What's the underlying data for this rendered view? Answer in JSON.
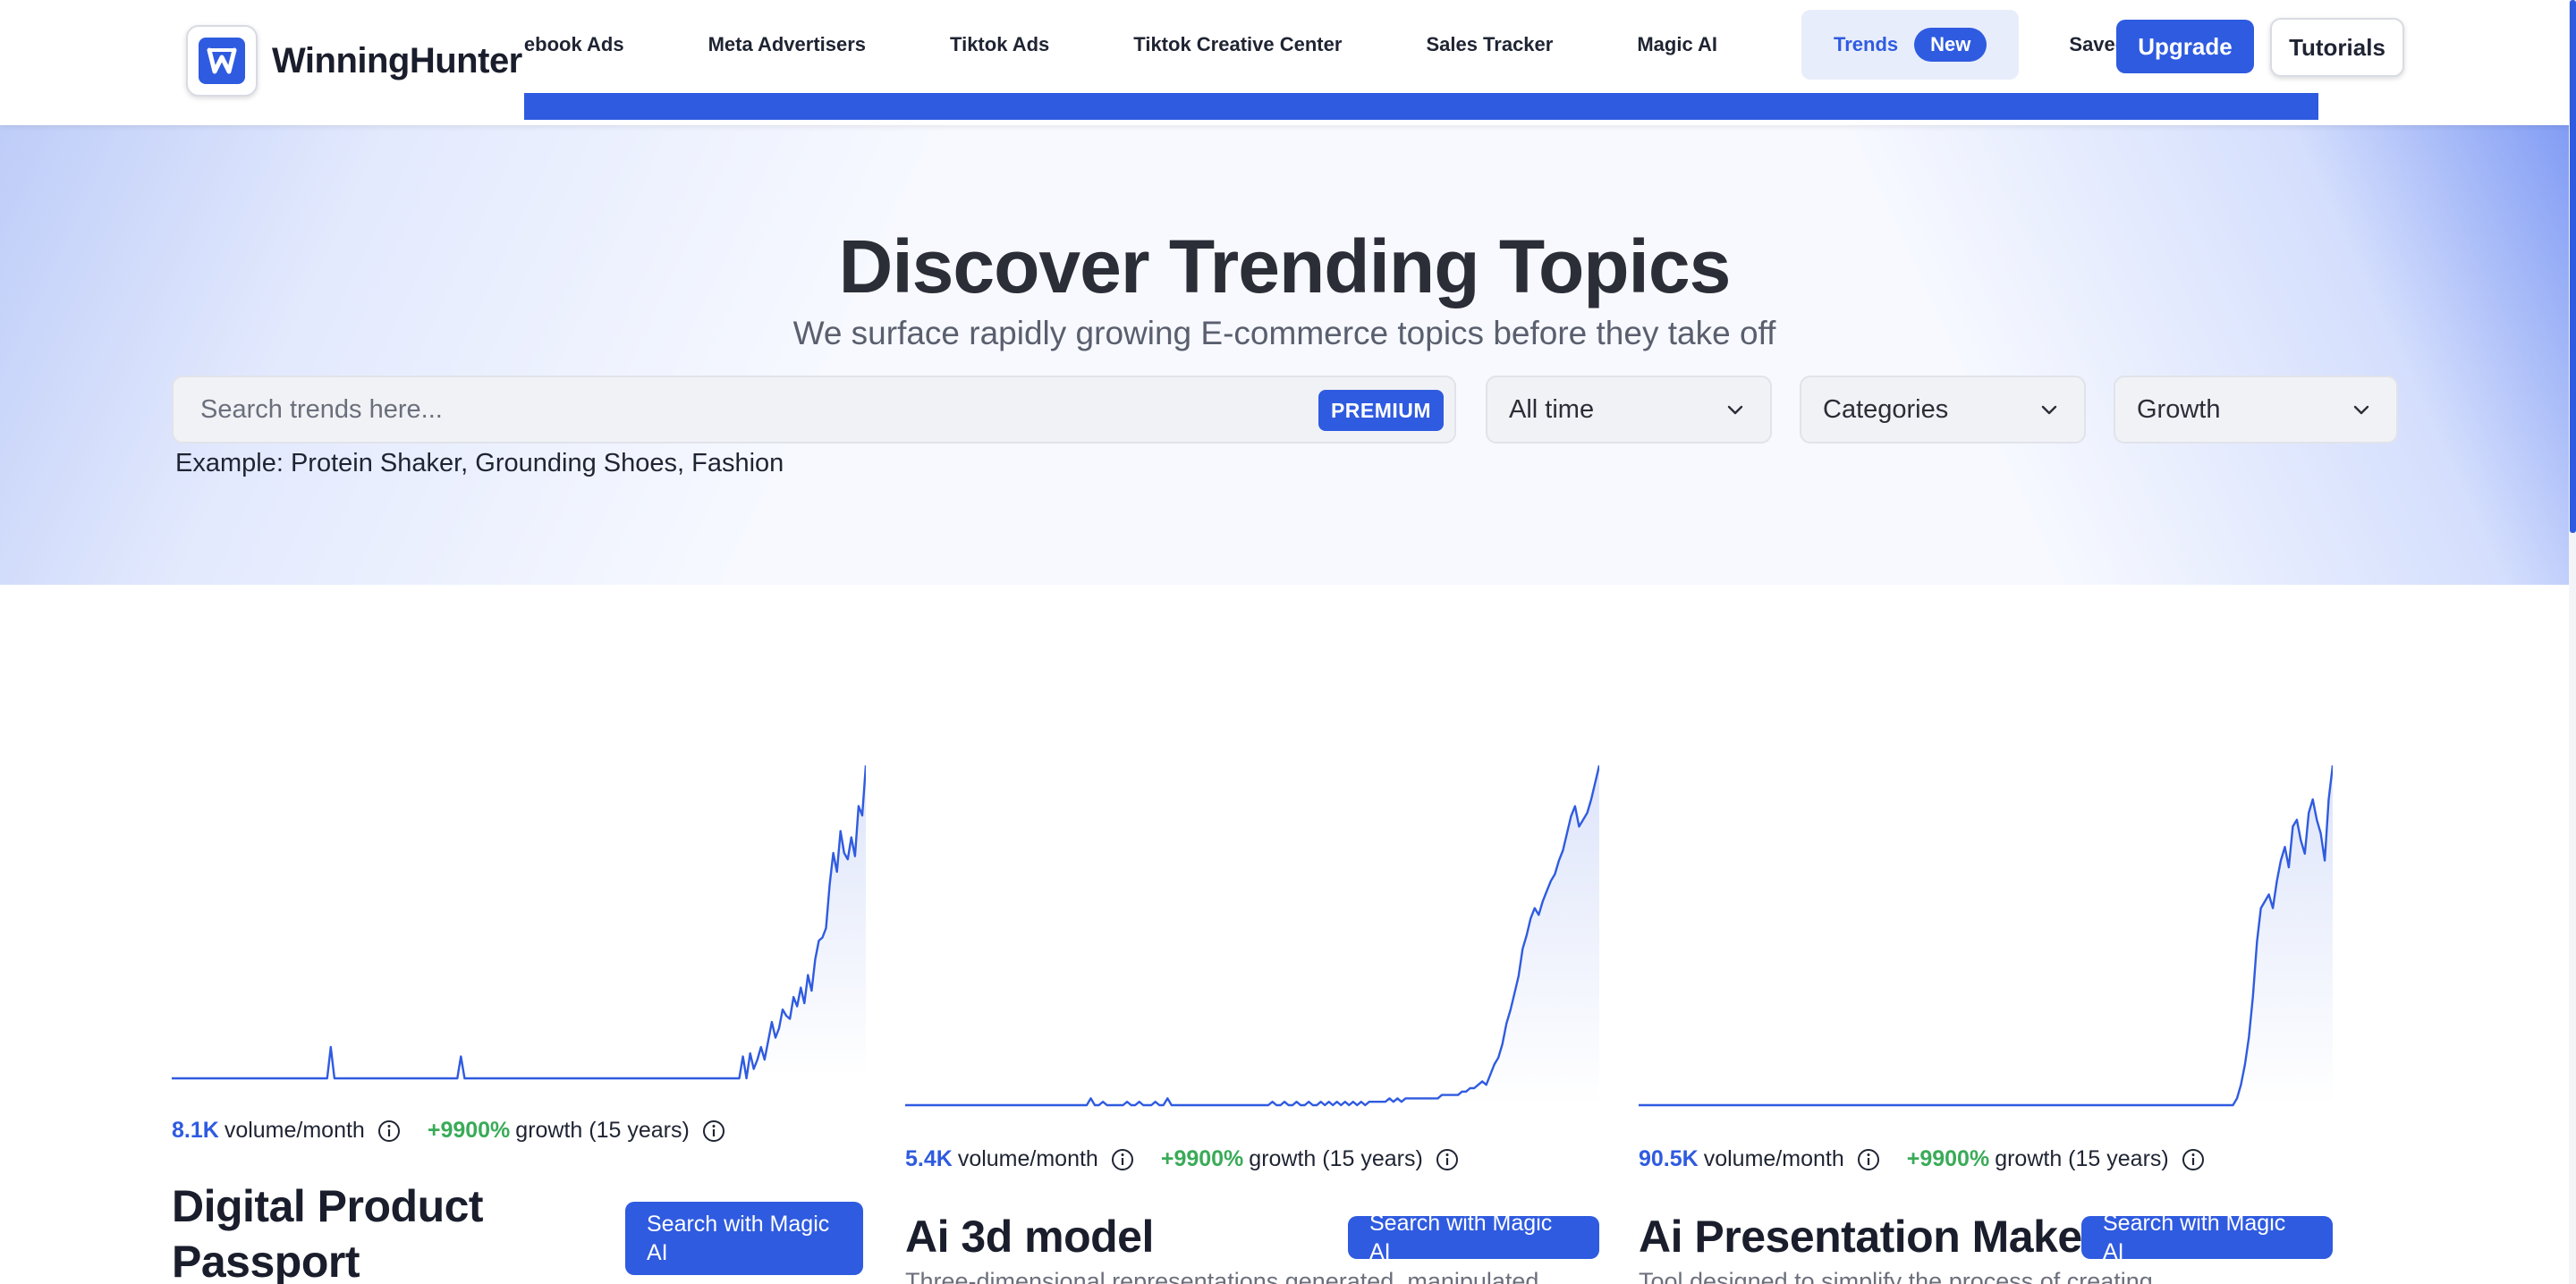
{
  "brand": {
    "name": "WinningHunter"
  },
  "nav": {
    "items": [
      "Facebook Ads",
      "Meta Advertisers",
      "Tiktok Ads",
      "Tiktok Creative Center",
      "Sales Tracker",
      "Magic AI"
    ],
    "trends_label": "Trends",
    "trends_badge": "New",
    "saved_label": "Saved Ads",
    "upgrade_label": "Upgrade",
    "tutorials_label": "Tutorials"
  },
  "hero": {
    "title": "Discover Trending Topics",
    "subtitle": "We surface rapidly growing E-commerce topics before they take off",
    "search_placeholder": "Search trends here...",
    "premium_label": "PREMIUM",
    "filters": {
      "time": "All time",
      "category": "Categories",
      "sort": "Growth"
    },
    "example": "Example: Protein Shaker, Grounding Shoes, Fashion"
  },
  "colors": {
    "accent": "#2f5be0",
    "growth": "#3aab58",
    "text": "#1f2433"
  },
  "icons": {
    "info": "info-icon",
    "chevron": "chevron-down-icon"
  },
  "cards": [
    {
      "volume": "8.1K",
      "volume_suffix": "volume/month",
      "growth": "+9900%",
      "growth_suffix": "growth (15 years)",
      "title": "Digital Product Passport",
      "button": "Search with Magic AI",
      "description": ""
    },
    {
      "volume": "5.4K",
      "volume_suffix": "volume/month",
      "growth": "+9900%",
      "growth_suffix": "growth (15 years)",
      "title": "Ai 3d model",
      "button": "Search with Magic AI",
      "description": "Three-dimensional representations generated, manipulated"
    },
    {
      "volume": "90.5K",
      "volume_suffix": "volume/month",
      "growth": "+9900%",
      "growth_suffix": "growth (15 years)",
      "title": "Ai Presentation Maker",
      "button": "Search with Magic AI",
      "description": "Tool designed to simplify the process of creating"
    }
  ],
  "chart_data": [
    {
      "type": "area",
      "series": [
        {
          "values": [
            0,
            0,
            0,
            0,
            0,
            0,
            0,
            0,
            0,
            0,
            0,
            0,
            0,
            0,
            0,
            0,
            0,
            0,
            0,
            0,
            0,
            0,
            0,
            0,
            0,
            0,
            0,
            0,
            0,
            0,
            0,
            0,
            0,
            0,
            0,
            0,
            0,
            0,
            0,
            0,
            0,
            0,
            0,
            0,
            10,
            0,
            0,
            0,
            0,
            0,
            0,
            0,
            0,
            0,
            0,
            0,
            0,
            0,
            0,
            0,
            0,
            0,
            0,
            0,
            0,
            0,
            0,
            0,
            0,
            0,
            0,
            0,
            0,
            0,
            0,
            0,
            0,
            0,
            0,
            0,
            7,
            0,
            0,
            0,
            0,
            0,
            0,
            0,
            0,
            0,
            0,
            0,
            0,
            0,
            0,
            0,
            0,
            0,
            0,
            0,
            0,
            0,
            0,
            0,
            0,
            0,
            0,
            0,
            0,
            0,
            0,
            0,
            0,
            0,
            0,
            0,
            0,
            0,
            0,
            0,
            0,
            0,
            0,
            0,
            0,
            0,
            0,
            0,
            0,
            0,
            0,
            0,
            0,
            0,
            0,
            0,
            0,
            0,
            0,
            0,
            0,
            0,
            0,
            0,
            0,
            0,
            0,
            0,
            0,
            0,
            0,
            0,
            0,
            0,
            0,
            0,
            0,
            0,
            7,
            0,
            8,
            3,
            6,
            10,
            6,
            12,
            18,
            13,
            16,
            22,
            20,
            19,
            26,
            23,
            29,
            24,
            33,
            28,
            38,
            44,
            45,
            48,
            62,
            72,
            66,
            79,
            72,
            70,
            77,
            71,
            87,
            84,
            100
          ]
        }
      ]
    },
    {
      "type": "area",
      "series": [
        {
          "values": [
            0,
            0,
            0,
            0,
            0,
            0,
            0,
            0,
            0,
            0,
            0,
            0,
            0,
            0,
            0,
            0,
            0,
            0,
            0,
            0,
            0,
            0,
            0,
            0,
            0,
            0,
            0,
            0,
            0,
            0,
            0,
            0,
            0,
            0,
            0,
            0,
            0,
            0,
            0,
            0,
            0,
            0,
            0,
            0,
            0,
            0,
            2,
            0,
            0,
            1,
            0,
            0,
            0,
            0,
            0,
            1,
            0,
            0,
            1,
            0,
            0,
            0,
            1,
            0,
            0,
            2,
            0,
            0,
            0,
            0,
            0,
            0,
            0,
            0,
            0,
            0,
            0,
            0,
            0,
            0,
            0,
            0,
            0,
            0,
            0,
            0,
            0,
            0,
            0,
            0,
            0,
            1,
            0,
            0,
            1,
            0,
            0,
            1,
            0,
            0,
            1,
            0,
            0,
            1,
            0,
            1,
            0,
            1,
            0,
            1,
            0,
            1,
            0,
            1,
            0,
            1,
            1,
            1,
            1,
            1,
            2,
            1,
            2,
            1,
            2,
            2,
            2,
            2,
            2,
            2,
            2,
            2,
            2,
            3,
            3,
            3,
            3,
            3,
            4,
            4,
            5,
            5,
            6,
            7,
            6,
            9,
            12,
            14,
            18,
            24,
            28,
            33,
            38,
            46,
            50,
            55,
            58,
            56,
            60,
            63,
            66,
            68,
            72,
            75,
            80,
            85,
            88,
            82,
            84,
            86,
            90,
            95,
            100
          ]
        }
      ]
    },
    {
      "type": "area",
      "series": [
        {
          "values": [
            0,
            0,
            0,
            0,
            0,
            0,
            0,
            0,
            0,
            0,
            0,
            0,
            0,
            0,
            0,
            0,
            0,
            0,
            0,
            0,
            0,
            0,
            0,
            0,
            0,
            0,
            0,
            0,
            0,
            0,
            0,
            0,
            0,
            0,
            0,
            0,
            0,
            0,
            0,
            0,
            0,
            0,
            0,
            0,
            0,
            0,
            0,
            0,
            0,
            0,
            0,
            0,
            0,
            0,
            0,
            0,
            0,
            0,
            0,
            0,
            0,
            0,
            0,
            0,
            0,
            0,
            0,
            0,
            0,
            0,
            0,
            0,
            0,
            0,
            0,
            0,
            0,
            0,
            0,
            0,
            0,
            0,
            0,
            0,
            0,
            0,
            0,
            0,
            0,
            0,
            0,
            0,
            0,
            0,
            0,
            0,
            0,
            0,
            0,
            0,
            0,
            0,
            0,
            0,
            0,
            0,
            0,
            0,
            0,
            0,
            0,
            0,
            0,
            0,
            0,
            0,
            0,
            0,
            0,
            0,
            0,
            0,
            0,
            0,
            0,
            0,
            0,
            0,
            0,
            0,
            0,
            0,
            0,
            0,
            0,
            0,
            0,
            0,
            0,
            0,
            0,
            0,
            0,
            0,
            0,
            0,
            0,
            0,
            0,
            0,
            2,
            6,
            12,
            20,
            32,
            48,
            58,
            60,
            62,
            58,
            66,
            72,
            76,
            70,
            82,
            84,
            78,
            74,
            86,
            90,
            84,
            80,
            72,
            90,
            100
          ]
        }
      ]
    }
  ]
}
